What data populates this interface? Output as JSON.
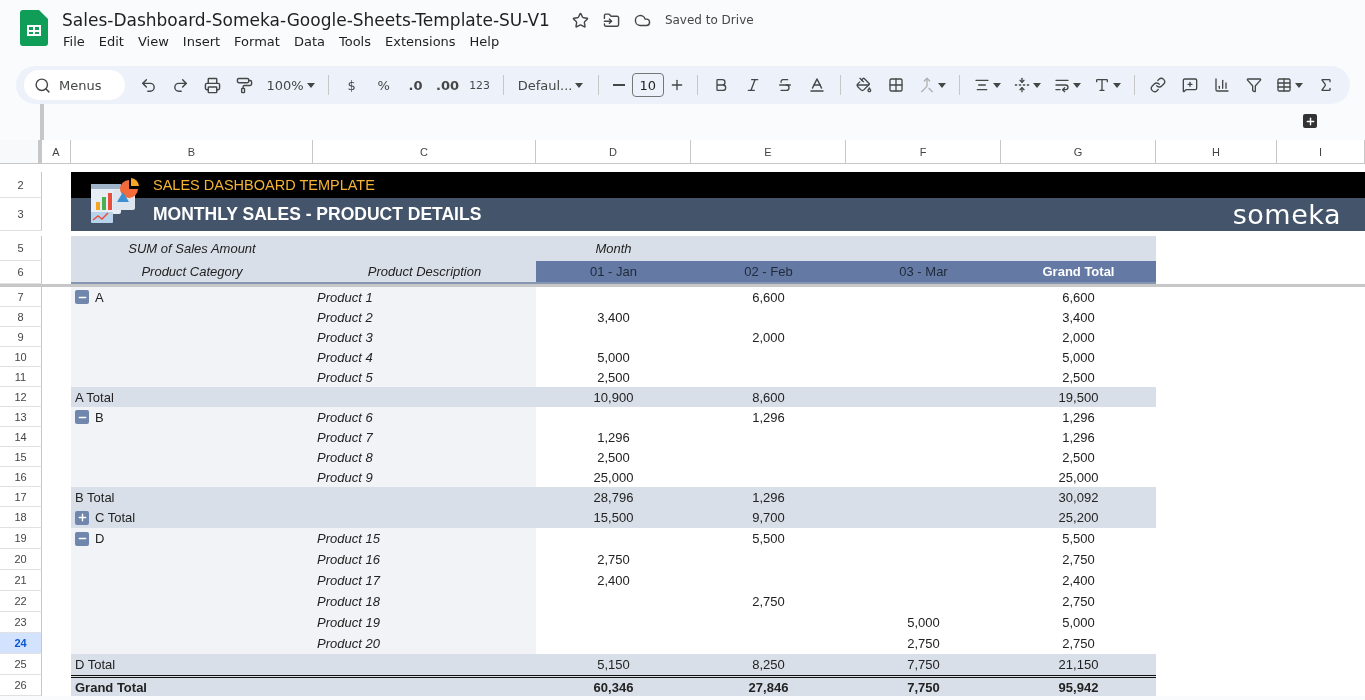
{
  "document": {
    "title": "Sales-Dashboard-Someka-Google-Sheets-Template-SU-V1",
    "status": "Saved to Drive"
  },
  "menu": [
    "File",
    "Edit",
    "View",
    "Insert",
    "Format",
    "Data",
    "Tools",
    "Extensions",
    "Help"
  ],
  "toolbar": {
    "search_placeholder": "Menus",
    "zoom": "100%",
    "currency": "$",
    "percent": "%",
    "decrease_decimals": ".0",
    "increase_decimals": ".00",
    "number_format": "123",
    "font": "Defaul...",
    "font_size": "10"
  },
  "column_headers": [
    "A",
    "B",
    "C",
    "D",
    "E",
    "F",
    "G",
    "H",
    "I"
  ],
  "header_rows": [
    {
      "number": "2",
      "selected": false
    },
    {
      "number": "3",
      "selected": false
    },
    {
      "number": "5",
      "selected": false
    },
    {
      "number": "6",
      "selected": false
    }
  ],
  "banner": {
    "subtitle": "SALES DASHBOARD TEMPLATE",
    "title": "MONTHLY SALES - PRODUCT DETAILS",
    "logo": "someka"
  },
  "pivot": {
    "value_label": "SUM of Sales Amount",
    "column_label": "Month",
    "row_labels": [
      "Product Category",
      "Product Description"
    ],
    "columns": [
      "01 - Jan",
      "02 - Feb",
      "03 - Mar",
      "Grand Total"
    ],
    "rows": [
      {
        "number": "7",
        "selected": false,
        "kind": "item",
        "category": "A",
        "expanded": true,
        "product": "Product 1",
        "values": {
          "feb": "6,600",
          "grand_total": "6,600"
        }
      },
      {
        "number": "8",
        "selected": false,
        "kind": "item",
        "product": "Product 2",
        "values": {
          "jan": "3,400",
          "grand_total": "3,400"
        }
      },
      {
        "number": "9",
        "selected": false,
        "kind": "item",
        "product": "Product 3",
        "values": {
          "feb": "2,000",
          "grand_total": "2,000"
        }
      },
      {
        "number": "10",
        "selected": false,
        "kind": "item",
        "product": "Product 4",
        "values": {
          "jan": "5,000",
          "grand_total": "5,000"
        }
      },
      {
        "number": "11",
        "selected": false,
        "kind": "item",
        "product": "Product 5",
        "values": {
          "jan": "2,500",
          "grand_total": "2,500"
        }
      },
      {
        "number": "12",
        "selected": false,
        "kind": "subtotal",
        "category": "A Total",
        "values": {
          "jan": "10,900",
          "feb": "8,600",
          "grand_total": "19,500"
        }
      },
      {
        "number": "13",
        "selected": false,
        "kind": "item",
        "category": "B",
        "expanded": true,
        "product": "Product 6",
        "values": {
          "feb": "1,296",
          "grand_total": "1,296"
        }
      },
      {
        "number": "14",
        "selected": false,
        "kind": "item",
        "product": "Product 7",
        "values": {
          "jan": "1,296",
          "grand_total": "1,296"
        }
      },
      {
        "number": "15",
        "selected": false,
        "kind": "item",
        "product": "Product 8",
        "values": {
          "jan": "2,500",
          "grand_total": "2,500"
        }
      },
      {
        "number": "16",
        "selected": false,
        "kind": "item",
        "product": "Product 9",
        "values": {
          "jan": "25,000",
          "grand_total": "25,000"
        }
      },
      {
        "number": "17",
        "selected": false,
        "kind": "subtotal",
        "category": "B Total",
        "values": {
          "jan": "28,796",
          "feb": "1,296",
          "grand_total": "30,092"
        }
      },
      {
        "number": "18",
        "selected": false,
        "kind": "subtotal",
        "category": "C Total",
        "expanded": false,
        "values": {
          "jan": "15,500",
          "feb": "9,700",
          "grand_total": "25,200"
        }
      },
      {
        "number": "19",
        "selected": false,
        "kind": "item",
        "category": "D",
        "expanded": true,
        "product": "Product 15",
        "values": {
          "feb": "5,500",
          "grand_total": "5,500"
        }
      },
      {
        "number": "20",
        "selected": false,
        "kind": "item",
        "product": "Product 16",
        "values": {
          "jan": "2,750",
          "grand_total": "2,750"
        }
      },
      {
        "number": "21",
        "selected": false,
        "kind": "item",
        "product": "Product 17",
        "values": {
          "jan": "2,400",
          "grand_total": "2,400"
        }
      },
      {
        "number": "22",
        "selected": false,
        "kind": "item",
        "product": "Product 18",
        "values": {
          "feb": "2,750",
          "grand_total": "2,750"
        }
      },
      {
        "number": "23",
        "selected": false,
        "kind": "item",
        "product": "Product 19",
        "values": {
          "mar": "5,000",
          "grand_total": "5,000"
        }
      },
      {
        "number": "24",
        "selected": true,
        "kind": "item",
        "product": "Product 20",
        "values": {
          "mar": "2,750",
          "grand_total": "2,750"
        }
      },
      {
        "number": "25",
        "selected": false,
        "kind": "subtotal",
        "category": "D Total",
        "values": {
          "jan": "5,150",
          "feb": "8,250",
          "mar": "7,750",
          "grand_total": "21,150"
        }
      },
      {
        "number": "26",
        "selected": false,
        "kind": "grand",
        "category": "Grand Total",
        "values": {
          "jan": "60,346",
          "feb": "27,846",
          "mar": "7,750",
          "grand_total": "95,942"
        }
      }
    ]
  }
}
